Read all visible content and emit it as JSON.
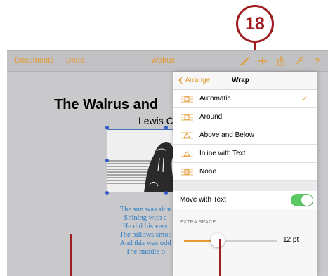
{
  "callout": {
    "number": "18"
  },
  "toolbar": {
    "documents": "Documents",
    "undo": "Undo",
    "title": "Walrus",
    "icons": [
      "paintbrush-icon",
      "plus-icon",
      "share-icon",
      "wrench-icon",
      "help-icon"
    ]
  },
  "document": {
    "title": "The Walrus and",
    "author": "Lewis C",
    "image": "walrus-illustration",
    "poem": [
      "The sun was shin",
      "Shining with a",
      "He did his very",
      "The billows smoo",
      "And this was odd",
      "The middle o"
    ]
  },
  "popover": {
    "back_label": "Arrange",
    "title": "Wrap",
    "options": [
      {
        "label": "Automatic",
        "selected": true
      },
      {
        "label": "Around",
        "selected": false
      },
      {
        "label": "Above and Below",
        "selected": false
      },
      {
        "label": "Inline with Text",
        "selected": false
      },
      {
        "label": "None",
        "selected": false
      }
    ],
    "move_with_text": {
      "label": "Move with Text",
      "on": true
    },
    "extra_space": {
      "label": "EXTRA SPACE",
      "value_text": "12 pt",
      "fraction": 0.36
    }
  },
  "colors": {
    "accent": "#e39b35",
    "callout": "#a01d20",
    "toggle_on": "#5ac864",
    "poem_text": "#2e7dc3",
    "selection": "#2f5cc4"
  }
}
